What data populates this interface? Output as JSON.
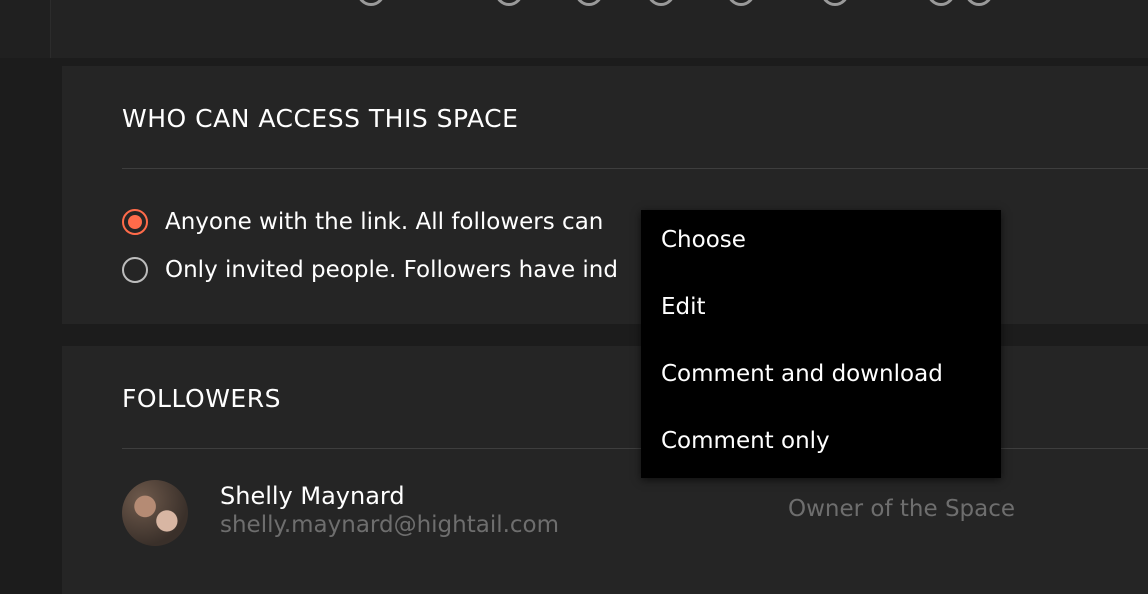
{
  "access": {
    "title": "WHO CAN ACCESS THIS SPACE",
    "options": [
      {
        "label": "Anyone with the link. All followers can",
        "selected": true
      },
      {
        "label": "Only invited people. Followers have ind",
        "selected": false
      }
    ]
  },
  "followers": {
    "title": "FOLLOWERS",
    "items": [
      {
        "name": "Shelly Maynard",
        "email": "shelly.maynard@hightail.com",
        "role": "Owner of the Space"
      }
    ]
  },
  "permission_menu": {
    "items": [
      {
        "label": "Choose"
      },
      {
        "label": "Edit"
      },
      {
        "label": "Comment and download"
      },
      {
        "label": "Comment only"
      }
    ]
  },
  "colors": {
    "accent": "#ff6b4a",
    "background": "#1c1c1c",
    "panel": "#252525",
    "menu": "#000000",
    "muted_text": "#6e6e6e"
  }
}
